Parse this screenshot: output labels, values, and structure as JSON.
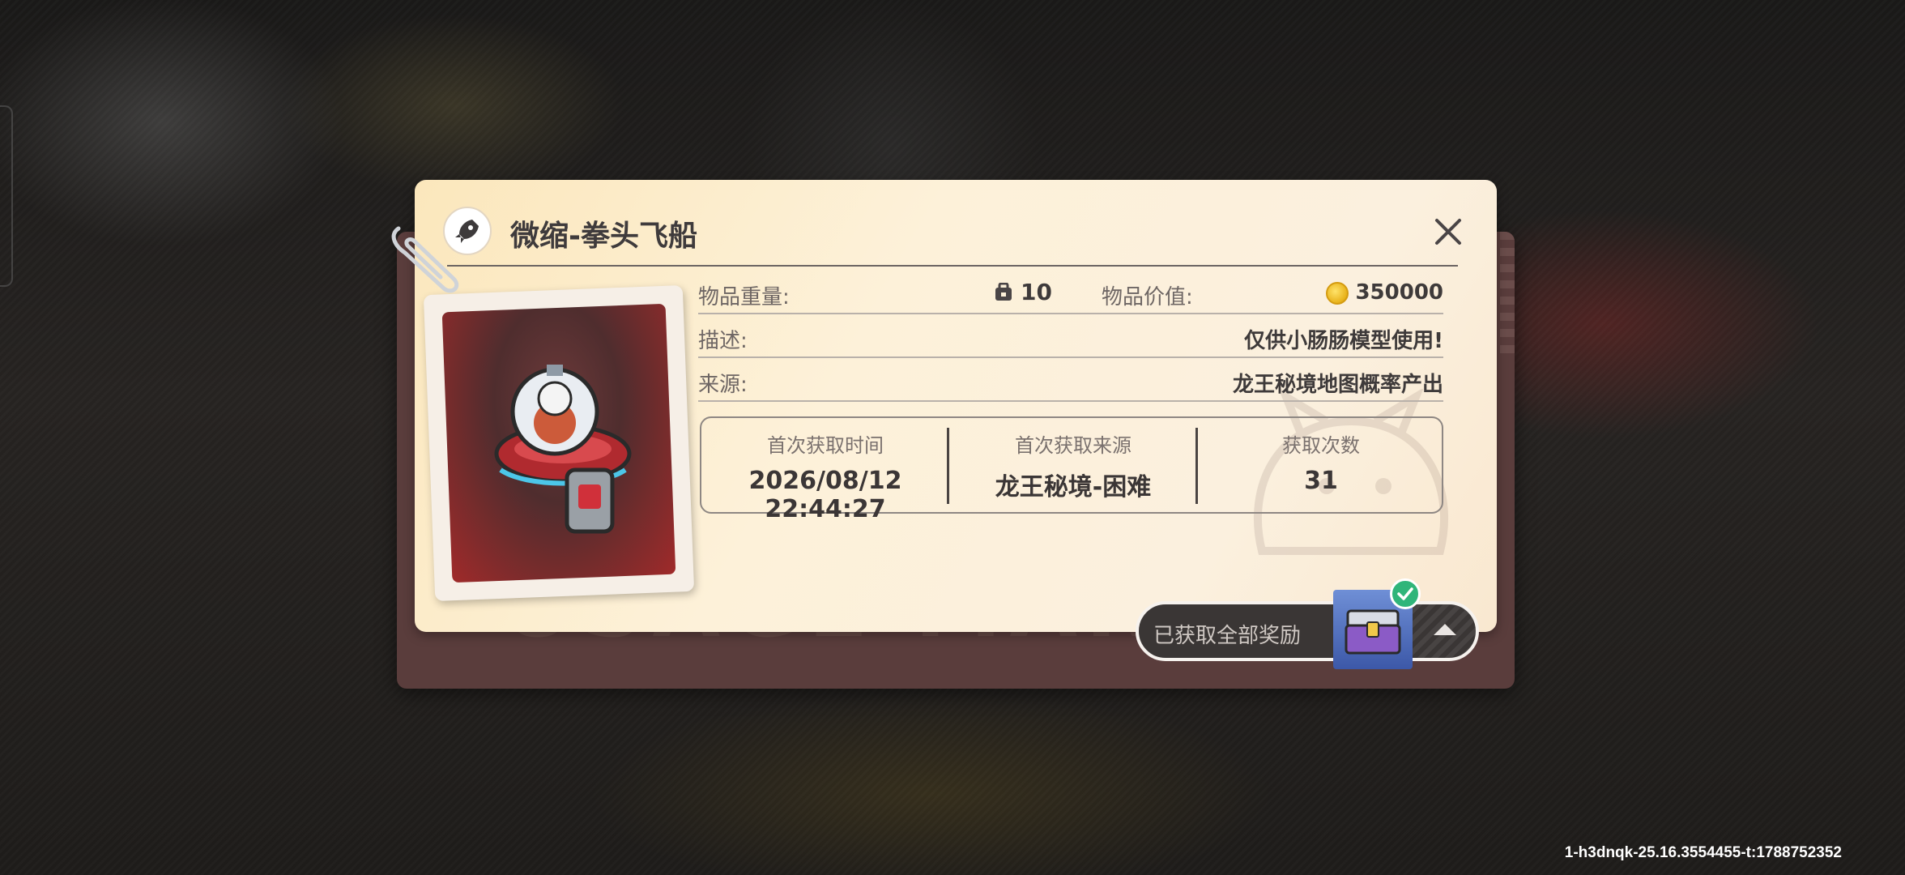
{
  "item": {
    "title": "微缩-拳头飞船",
    "weight_label": "物品重量:",
    "weight_value": "10",
    "value_label": "物品价值:",
    "value_amount": "350000",
    "desc_label": "描述:",
    "desc_value": "仅供小肠肠模型使用!",
    "source_label": "来源:",
    "source_value": "龙王秘境地图概率产出"
  },
  "stats": {
    "first_time_label": "首次获取时间",
    "first_time_value": "2026/08/12 22:44:27",
    "first_source_label": "首次获取来源",
    "first_source_value": "龙王秘境-困难",
    "count_label": "获取次数",
    "count_value": "31"
  },
  "reward": {
    "label": "已获取全部奖励"
  },
  "watermark": "USAGE MAN",
  "build_info": "1-h3dnqk-25.16.3554455-t:1788752352",
  "colors": {
    "card_bg": "#fdf1d9",
    "back_card": "#5a3d3c",
    "frame_red": "#a02a2a",
    "check_green": "#2fb57a",
    "reward_box_blue": "#3c58a8"
  }
}
